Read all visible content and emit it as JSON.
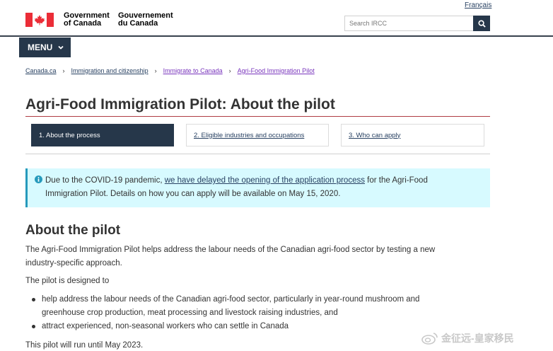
{
  "header": {
    "language_toggle": "Français",
    "signature_en_line1": "Government",
    "signature_en_line2": "of Canada",
    "signature_fr_line1": "Gouvernement",
    "signature_fr_line2": "du Canada",
    "search_placeholder": "Search IRCC",
    "menu_label": "MENU"
  },
  "breadcrumb": [
    "Canada.ca",
    "Immigration and citizenship",
    "Immigrate to Canada",
    "Agri-Food Immigration Pilot"
  ],
  "page_title": "Agri-Food Immigration Pilot: About the pilot",
  "steps": [
    {
      "label": "1. About the process",
      "active": true
    },
    {
      "label": "2. Eligible industries and occupations",
      "active": false
    },
    {
      "label": "3. Who can apply",
      "active": false
    }
  ],
  "alert": {
    "before_link": "Due to the COVID-19 pandemic, ",
    "link_text": "we have delayed the opening of the application process",
    "after_link": " for the Agri-Food",
    "line2": "Immigration Pilot. Details on how you can apply will be available on May 15, 2020."
  },
  "section": {
    "heading": "About the pilot",
    "intro_line1": "The Agri-Food Immigration Pilot helps address the labour needs of the Canadian agri-food sector by testing a new",
    "intro_line2": "industry-specific approach.",
    "designed_to": "The pilot is designed to",
    "bullets": [
      {
        "line1": "help address the labour needs of the Canadian agri-food sector, particularly in year-round mushroom and",
        "line2": "greenhouse crop production, meat processing and livestock raising industries, and"
      },
      {
        "line1": "attract experienced, non-seasonal workers who can settle in Canada",
        "line2": ""
      }
    ],
    "runs_until": "This pilot will run until May 2023."
  },
  "watermark": "金征远-皇家移民",
  "colors": {
    "gc_blue": "#26374a",
    "link": "#284162",
    "visited_link": "#7834bc",
    "title_rule": "#af3c43",
    "alert_bg": "#d7faff",
    "alert_border": "#269abc",
    "flag_red": "#eb2d37"
  }
}
